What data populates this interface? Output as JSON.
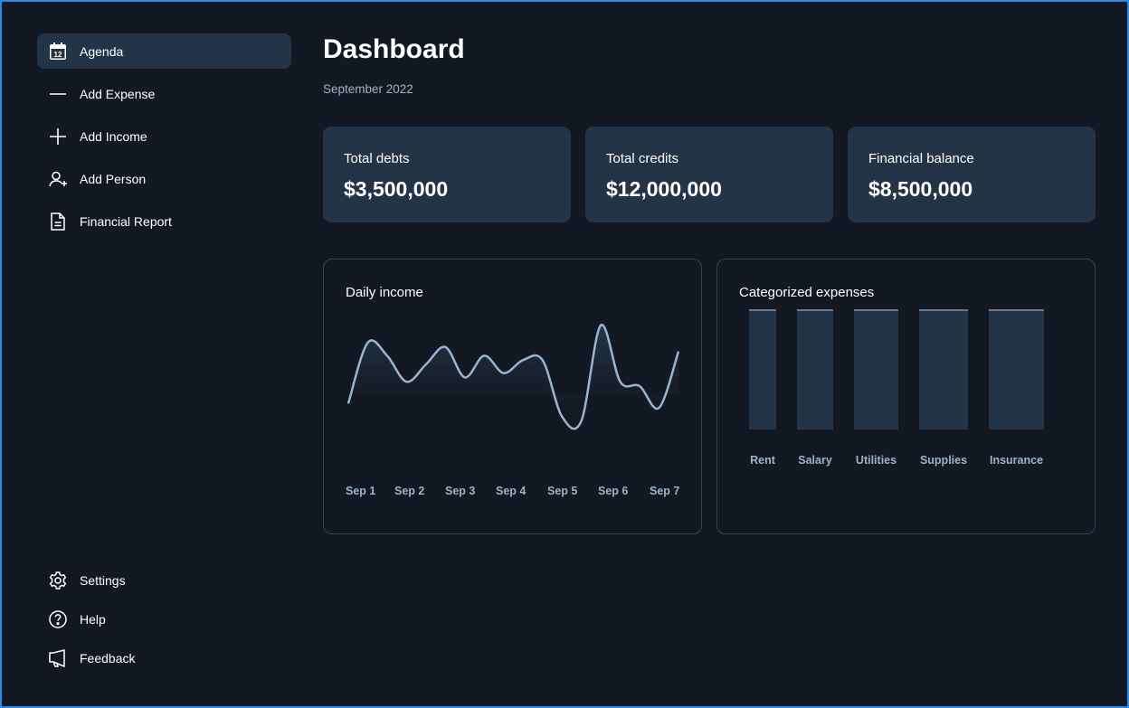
{
  "sidebar": {
    "items": [
      {
        "label": "Agenda",
        "icon": "calendar-icon",
        "active": true
      },
      {
        "label": "Add Expense",
        "icon": "minus-icon"
      },
      {
        "label": "Add Income",
        "icon": "plus-icon"
      },
      {
        "label": "Add Person",
        "icon": "user-plus-icon"
      },
      {
        "label": "Financial Report",
        "icon": "document-icon"
      }
    ],
    "bottom_items": [
      {
        "label": "Settings",
        "icon": "gear-icon"
      },
      {
        "label": "Help",
        "icon": "help-icon"
      },
      {
        "label": "Feedback",
        "icon": "megaphone-icon"
      }
    ],
    "calendar_day": "12"
  },
  "header": {
    "title": "Dashboard",
    "subtitle": "September 2022"
  },
  "stats": [
    {
      "label": "Total debts",
      "value": "$3,500,000"
    },
    {
      "label": "Total credits",
      "value": "$12,000,000"
    },
    {
      "label": "Financial balance",
      "value": "$8,500,000"
    }
  ],
  "colors": {
    "background": "#131922",
    "card": "#243447",
    "line": "#9ab4cf",
    "muted_text": "#9fb2c8",
    "border": "#2f4256"
  },
  "chart_data": [
    {
      "type": "line",
      "title": "Daily income",
      "x": [
        "Sep 1",
        "Sep 2",
        "Sep 3",
        "Sep 4",
        "Sep 5",
        "Sep 6",
        "Sep 7"
      ],
      "series": [
        {
          "values": [
            0.3,
            1.0,
            0.85,
            0.55,
            0.75,
            0.95,
            0.6,
            0.85,
            0.65,
            0.8,
            0.8,
            0.15,
            0.1,
            1.2,
            0.55,
            0.5,
            0.25,
            0.9
          ]
        }
      ],
      "grid": false,
      "legend": "none"
    },
    {
      "type": "bar",
      "title": "Categorized expenses",
      "categories": [
        "Rent",
        "Salary",
        "Utilities",
        "Supplies",
        "Insurance"
      ],
      "values": [
        100,
        100,
        100,
        100,
        100
      ],
      "grid": false,
      "legend": "none"
    }
  ]
}
